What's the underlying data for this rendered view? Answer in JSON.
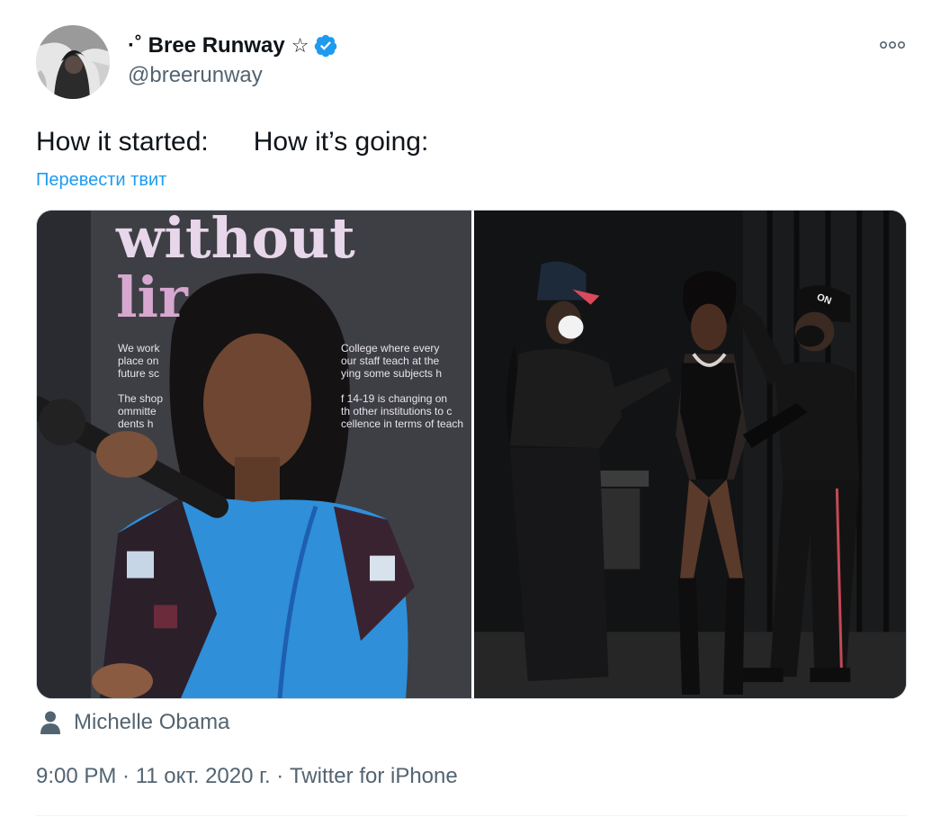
{
  "author": {
    "display_name": "·˚ Bree Runway",
    "name_symbol": "☆",
    "handle": "@breerunway",
    "verified": true,
    "avatar_icon": "profile-photo"
  },
  "menu": {
    "more_icon": "more-icon"
  },
  "tweet": {
    "text": "How it started:      How it’s going:",
    "translate_label": "Перевести твит"
  },
  "media": {
    "left_photo": {
      "sign_line1": "without",
      "sign_line2": "lir",
      "sign_text_left": "We work\nplace on\nfuture sc\n\nThe shop\nommitte\ndents h",
      "sign_text_right": "College where every\nour staff teach at the\nying some subjects h\n\nf 14-19 is changing on\nth other institutions to c\ncellence in terms of teach"
    },
    "right_photo": {
      "cap_text": "ON"
    }
  },
  "tagged": {
    "icon": "person-icon",
    "name": "Michelle Obama"
  },
  "meta": {
    "time": "9:00 PM",
    "date": "11 окт. 2020 г.",
    "separator": " · ",
    "source": "Twitter for iPhone"
  },
  "colors": {
    "accent": "#1d9bf0",
    "secondary_text": "#536471",
    "primary_text": "#0f1419"
  }
}
